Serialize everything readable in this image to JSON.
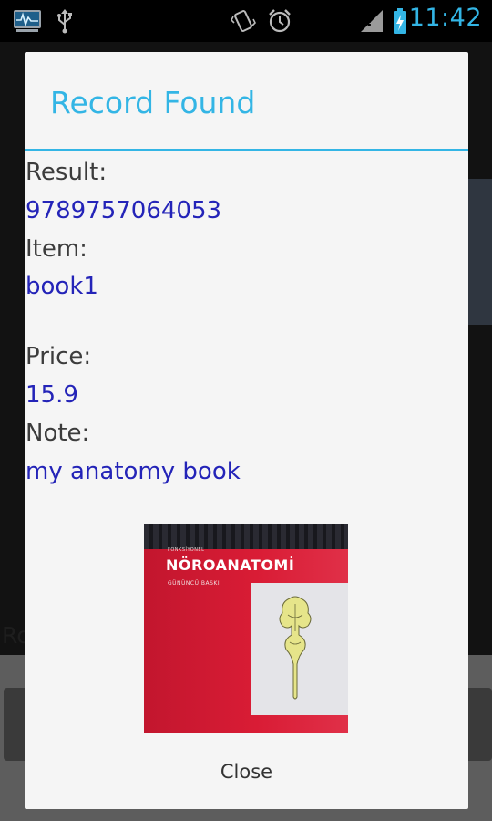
{
  "status_bar": {
    "time": "11:42",
    "icons": [
      "activity-monitor-icon",
      "usb-icon",
      "vibrate-icon",
      "alarm-icon",
      "no-signal-icon",
      "battery-charging-icon"
    ],
    "accent_color": "#33b5e5"
  },
  "background_activity": {
    "label": "Ro"
  },
  "dialog": {
    "title": "Record Found",
    "accent_color": "#33b5e5",
    "value_color": "#2424b8",
    "fields": {
      "result_label": "Result:",
      "result_value": "9789757064053",
      "item_label": "Item:",
      "item_value": "book1",
      "price_label": "Price:",
      "price_value": "15.9",
      "note_label": "Note:",
      "note_value": "my anatomy book"
    },
    "photo": {
      "cover_small_text": "FONKSİYONEL",
      "cover_title": "NÖROANATOMİ",
      "cover_subtitle": "GÜNÜNCÜ BASKI"
    },
    "close_label": "Close"
  }
}
